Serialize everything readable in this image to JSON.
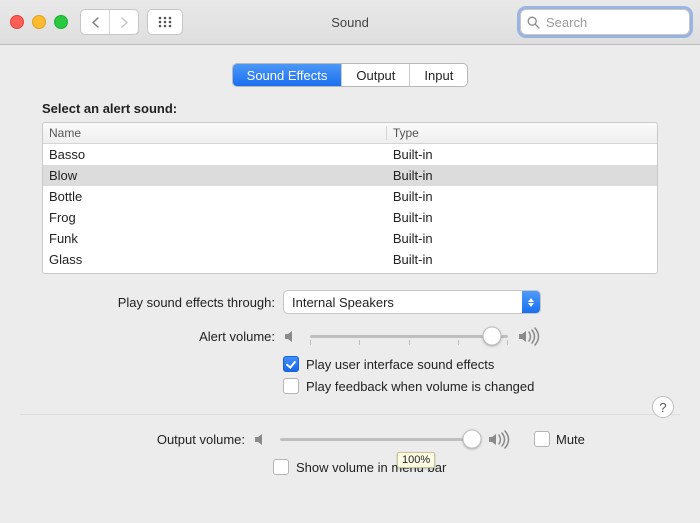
{
  "window": {
    "title": "Sound"
  },
  "search": {
    "placeholder": "Search"
  },
  "tabs": {
    "effects": "Sound Effects",
    "output": "Output",
    "input": "Input"
  },
  "heading": "Select an alert sound:",
  "columns": {
    "name": "Name",
    "type": "Type"
  },
  "sounds": [
    {
      "name": "Basso",
      "type": "Built-in"
    },
    {
      "name": "Blow",
      "type": "Built-in"
    },
    {
      "name": "Bottle",
      "type": "Built-in"
    },
    {
      "name": "Frog",
      "type": "Built-in"
    },
    {
      "name": "Funk",
      "type": "Built-in"
    },
    {
      "name": "Glass",
      "type": "Built-in"
    }
  ],
  "selected_sound_index": 1,
  "play_through": {
    "label": "Play sound effects through:",
    "value": "Internal Speakers"
  },
  "alert_volume": {
    "label": "Alert volume:",
    "percent": 92
  },
  "checks": {
    "ui_sounds": {
      "label": "Play user interface sound effects",
      "checked": true
    },
    "feedback": {
      "label": "Play feedback when volume is changed",
      "checked": false
    }
  },
  "output_volume": {
    "label": "Output volume:",
    "percent": 97,
    "tooltip": "100%"
  },
  "mute": {
    "label": "Mute",
    "checked": false
  },
  "menubar": {
    "label": "Show volume in menu bar",
    "checked": false
  },
  "help": "?"
}
